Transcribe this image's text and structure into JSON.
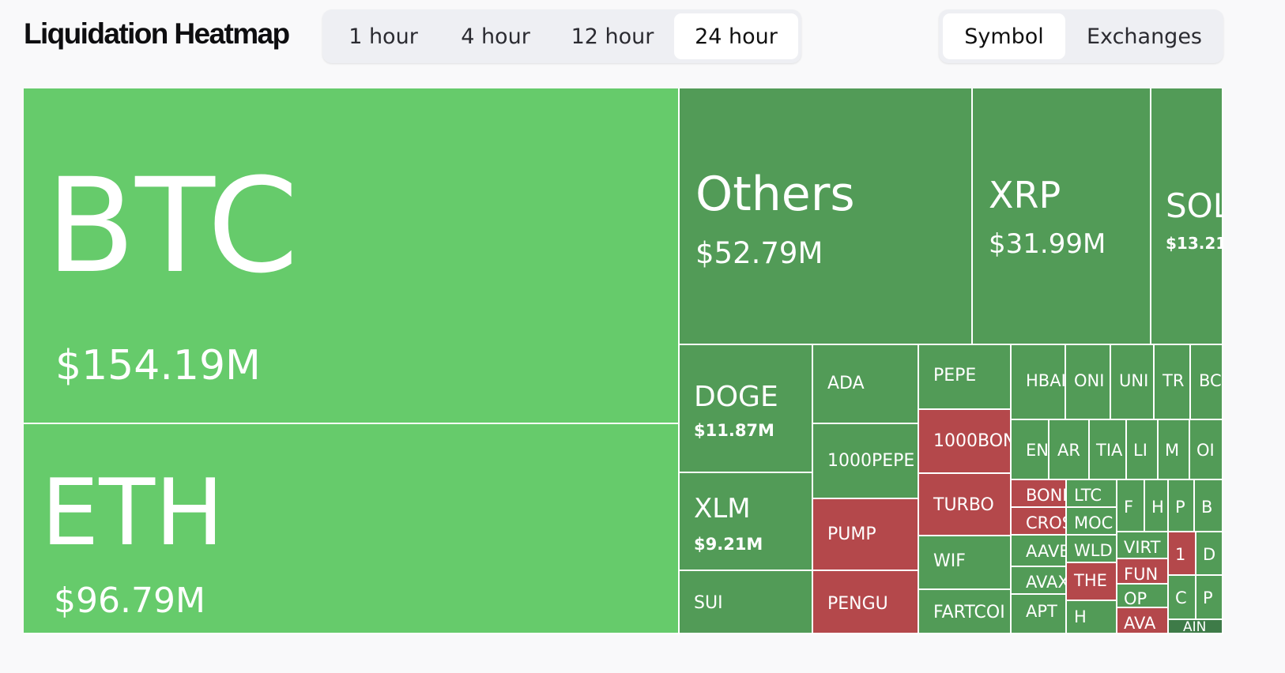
{
  "header": {
    "title": "Liquidation Heatmap",
    "time_tabs": [
      {
        "label": "1 hour",
        "active": false
      },
      {
        "label": "4 hour",
        "active": false
      },
      {
        "label": "12 hour",
        "active": false
      },
      {
        "label": "24 hour",
        "active": true
      }
    ],
    "view_tabs": [
      {
        "label": "Symbol",
        "active": true
      },
      {
        "label": "Exchanges",
        "active": false
      }
    ]
  },
  "colors": {
    "bright_green": "#66cb6b",
    "green": "#529b57",
    "red": "#b4484b",
    "dark_green": "#3e7b48"
  },
  "heatmap": [
    {
      "symbol": "BTC",
      "value": "$154.19M",
      "color": "bright_green"
    },
    {
      "symbol": "ETH",
      "value": "$96.79M",
      "color": "bright_green"
    },
    {
      "symbol": "Others",
      "value": "$52.79M",
      "color": "green"
    },
    {
      "symbol": "XRP",
      "value": "$31.99M",
      "color": "green"
    },
    {
      "symbol": "SOL",
      "value": "$13.21",
      "color": "green"
    },
    {
      "symbol": "DOGE",
      "value": "$11.87M",
      "color": "green"
    },
    {
      "symbol": "XLM",
      "value": "$9.21M",
      "color": "green"
    },
    {
      "symbol": "SUI",
      "value": "",
      "color": "green"
    },
    {
      "symbol": "ADA",
      "value": "",
      "color": "green"
    },
    {
      "symbol": "1000PEPE",
      "value": "",
      "color": "green"
    },
    {
      "symbol": "PUMP",
      "value": "",
      "color": "red"
    },
    {
      "symbol": "PENGU",
      "value": "",
      "color": "red"
    },
    {
      "symbol": "PEPE",
      "value": "",
      "color": "green"
    },
    {
      "symbol": "1000BON",
      "value": "",
      "color": "red"
    },
    {
      "symbol": "TURBO",
      "value": "",
      "color": "red"
    },
    {
      "symbol": "WIF",
      "value": "",
      "color": "green"
    },
    {
      "symbol": "FARTCOI",
      "value": "",
      "color": "green"
    },
    {
      "symbol": "HBAI",
      "value": "",
      "color": "green"
    },
    {
      "symbol": "ONI",
      "value": "",
      "color": "green"
    },
    {
      "symbol": "UNI",
      "value": "",
      "color": "green"
    },
    {
      "symbol": "TR",
      "value": "",
      "color": "green"
    },
    {
      "symbol": "BC",
      "value": "",
      "color": "green"
    },
    {
      "symbol": "EN",
      "value": "",
      "color": "green"
    },
    {
      "symbol": "AR",
      "value": "",
      "color": "green"
    },
    {
      "symbol": "TIA",
      "value": "",
      "color": "green"
    },
    {
      "symbol": "LI",
      "value": "",
      "color": "green"
    },
    {
      "symbol": "M",
      "value": "",
      "color": "green"
    },
    {
      "symbol": "OI",
      "value": "",
      "color": "green"
    },
    {
      "symbol": "BONI",
      "value": "",
      "color": "red"
    },
    {
      "symbol": "CROS",
      "value": "",
      "color": "red"
    },
    {
      "symbol": "AAVE",
      "value": "",
      "color": "green"
    },
    {
      "symbol": "AVAX",
      "value": "",
      "color": "green"
    },
    {
      "symbol": "APT",
      "value": "",
      "color": "green"
    },
    {
      "symbol": "LTC",
      "value": "",
      "color": "green"
    },
    {
      "symbol": "MOC",
      "value": "",
      "color": "green"
    },
    {
      "symbol": "WLD",
      "value": "",
      "color": "green"
    },
    {
      "symbol": "THE",
      "value": "",
      "color": "red"
    },
    {
      "symbol": "H",
      "value": "",
      "color": "green"
    },
    {
      "symbol": "F",
      "value": "",
      "color": "green"
    },
    {
      "symbol": "H",
      "value": "",
      "color": "green"
    },
    {
      "symbol": "P",
      "value": "",
      "color": "green"
    },
    {
      "symbol": "B",
      "value": "",
      "color": "green"
    },
    {
      "symbol": "VIRT",
      "value": "",
      "color": "green"
    },
    {
      "symbol": "FUN",
      "value": "",
      "color": "red"
    },
    {
      "symbol": "OP",
      "value": "",
      "color": "green"
    },
    {
      "symbol": "AVA",
      "value": "",
      "color": "red"
    },
    {
      "symbol": "1",
      "value": "",
      "color": "red"
    },
    {
      "symbol": "D",
      "value": "",
      "color": "green"
    },
    {
      "symbol": "C",
      "value": "",
      "color": "green"
    },
    {
      "symbol": "P",
      "value": "",
      "color": "green"
    },
    {
      "symbol": "AIN",
      "value": "",
      "color": "dark_green"
    }
  ]
}
